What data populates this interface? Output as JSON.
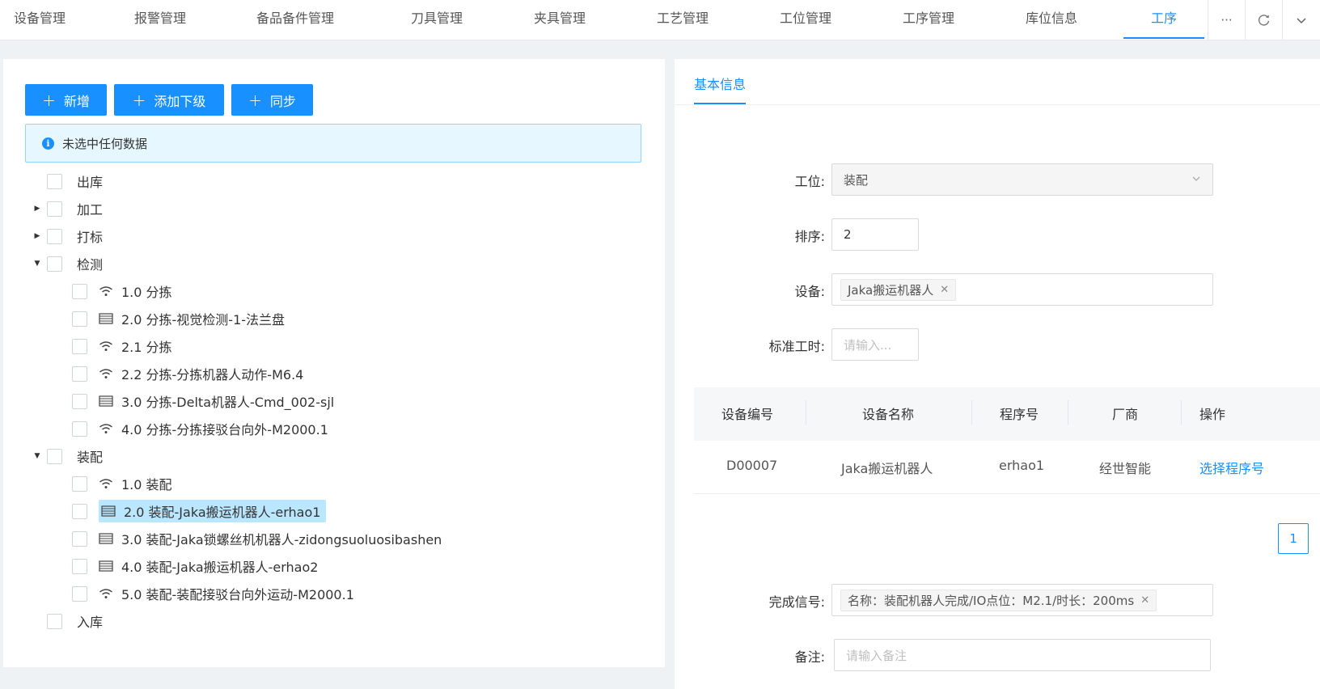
{
  "top_tabs": [
    {
      "label": "设备管理"
    },
    {
      "label": "报警管理"
    },
    {
      "label": "备品备件管理"
    },
    {
      "label": "刀具管理"
    },
    {
      "label": "夹具管理"
    },
    {
      "label": "工艺管理"
    },
    {
      "label": "工位管理"
    },
    {
      "label": "工序管理"
    },
    {
      "label": "库位信息"
    },
    {
      "label": "工序",
      "active": true
    }
  ],
  "top_tools": {
    "more": "···",
    "refresh_icon": "refresh-icon",
    "dropdown_icon": "chevron-down-icon"
  },
  "toolbar": {
    "add_label": "新增",
    "add_child_label": "添加下级",
    "sync_label": "同步"
  },
  "alert": {
    "text": "未选中任何数据"
  },
  "tree": {
    "nodes": [
      {
        "label": "出库",
        "level": 0,
        "caret": "none"
      },
      {
        "label": "加工",
        "level": 0,
        "caret": "collapsed"
      },
      {
        "label": "打标",
        "level": 0,
        "caret": "collapsed"
      },
      {
        "label": "检测",
        "level": 0,
        "caret": "expanded"
      },
      {
        "label": "1.0 分拣",
        "level": 1,
        "icon": "wifi-icon"
      },
      {
        "label": "2.0 分拣-视觉检测-1-法兰盘",
        "level": 1,
        "icon": "list-icon"
      },
      {
        "label": "2.1 分拣",
        "level": 1,
        "icon": "wifi-icon"
      },
      {
        "label": "2.2 分拣-分拣机器人动作-M6.4",
        "level": 1,
        "icon": "wifi-icon"
      },
      {
        "label": "3.0 分拣-Delta机器人-Cmd_002-sjl",
        "level": 1,
        "icon": "list-icon"
      },
      {
        "label": "4.0 分拣-分拣接驳台向外-M2000.1",
        "level": 1,
        "icon": "wifi-icon"
      },
      {
        "label": "装配",
        "level": 0,
        "caret": "expanded"
      },
      {
        "label": "1.0 装配",
        "level": 1,
        "icon": "wifi-icon"
      },
      {
        "label": "2.0 装配-Jaka搬运机器人-erhao1",
        "level": 1,
        "icon": "list-icon",
        "selected": true
      },
      {
        "label": "3.0 装配-Jaka锁螺丝机机器人-zidongsuoluosibashen",
        "level": 1,
        "icon": "list-icon"
      },
      {
        "label": "4.0 装配-Jaka搬运机器人-erhao2",
        "level": 1,
        "icon": "list-icon"
      },
      {
        "label": "5.0 装配-装配接驳台向外运动-M2000.1",
        "level": 1,
        "icon": "wifi-icon"
      },
      {
        "label": "入库",
        "level": 0,
        "caret": "none"
      }
    ]
  },
  "detail": {
    "tab_label": "基本信息",
    "station_label": "工位:",
    "station_value": "装配",
    "order_label": "排序:",
    "order_value": "2",
    "device_label": "设备:",
    "device_tag": "Jaka搬运机器人",
    "std_time_label": "标准工时:",
    "std_time_placeholder": "请输入...",
    "table": {
      "headers": [
        "设备编号",
        "设备名称",
        "程序号",
        "厂商",
        "操作"
      ],
      "rows": [
        {
          "code": "D00007",
          "name": "Jaka搬运机器人",
          "program": "erhao1",
          "vendor": "经世智能",
          "action": "选择程序号"
        }
      ]
    },
    "page_number": "1",
    "done_signal_label": "完成信号:",
    "done_signal_tag": "名称：装配机器人完成/IO点位：M2.1/时长：200ms",
    "remark_label": "备注:",
    "remark_placeholder": "请输入备注"
  },
  "colors": {
    "primary": "#1890ff",
    "alert_bg": "#e6f7ff",
    "selected_bg": "#bae7ff",
    "page_bg": "#eef2f4"
  }
}
